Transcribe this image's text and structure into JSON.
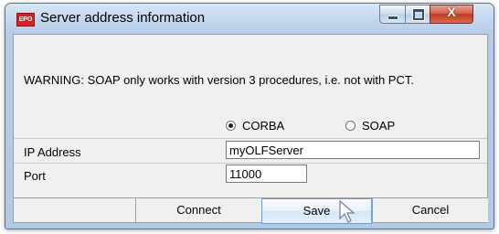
{
  "window": {
    "title": "Server address information",
    "icon_text": "EPO",
    "close_glyph": "X"
  },
  "warning": "WARNING: SOAP only works with version 3 procedures, i.e. not with PCT.",
  "protocol": {
    "options": [
      "CORBA",
      "SOAP"
    ],
    "selected": "CORBA"
  },
  "ip": {
    "label": "IP Address",
    "value": "myOLFServer"
  },
  "port": {
    "label": "Port",
    "value": "11000"
  },
  "buttons": {
    "connect": "Connect",
    "save": "Save",
    "cancel": "Cancel"
  }
}
